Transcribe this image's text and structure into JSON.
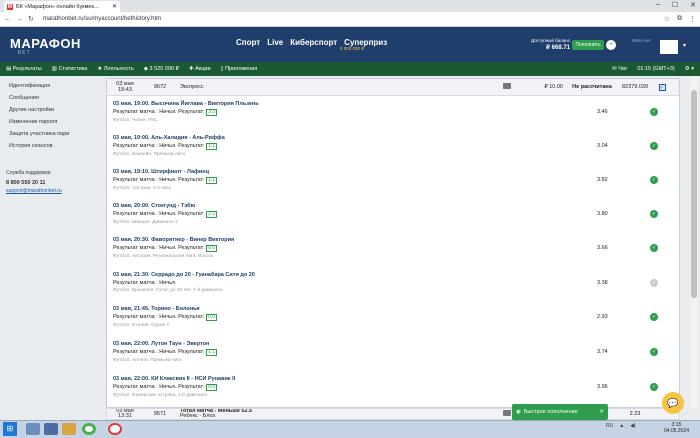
{
  "browser": {
    "tab_title": "БК «Марафон» онлайн букмек...",
    "url": "marathonbet.ru/su/myaccount/bethistory.htm"
  },
  "header": {
    "logo": "МАРАФОН",
    "logo_sub": "БЕТ",
    "nav": [
      "Спорт",
      "Live",
      "Киберспорт",
      "Суперприз"
    ],
    "superprize_amount": "5 000 000 ₽",
    "balance_label": "Доступный баланс",
    "balance_value": "₽ 668.71",
    "deposit_label": "Пополнить",
    "my_account_label": "Мой счет"
  },
  "subnav": {
    "items": [
      "Результаты",
      "Статистика",
      "Лояльность",
      "3 525 000 ₽",
      "Акции",
      "Приложения"
    ],
    "chat": "Чат",
    "time": "01:15 (GMT+3)"
  },
  "sidebar": {
    "items": [
      "Идентификация",
      "Сообщения",
      "Другие настройки",
      "Изменение пароля",
      "Защита участника пари",
      "История сеансов"
    ],
    "support_title": "Служба поддержки",
    "phone": "8 800 550 20 11",
    "email": "support@marathonbet.ru"
  },
  "bet1": {
    "date": "03 мая",
    "time": "18:43",
    "number": "9672",
    "type": "Экспресс",
    "stake": "₽ 10.00",
    "status": "Не рассчитана",
    "code": "82379.039"
  },
  "events": [
    {
      "title": "03 мая, 19:00. Высочина Йиглава - Виктория Пльзень",
      "result": "Результат матча : Ничья. Результат:",
      "score": "3:3",
      "league": "Футбол. Чехия. FNL",
      "odds": "3.46",
      "state": "win"
    },
    {
      "title": "03 мая, 19:00. Аль-Халидия - Аль-Риффа",
      "result": "Результат матча : Ничья. Результат:",
      "score": "1:1",
      "league": "Футбол. Бахрейн. Премьер-лига",
      "odds": "3.04",
      "state": "win"
    },
    {
      "title": "03 мая, 19:10. Штирфингг - Лафинц",
      "result": "Результат матча : Ничья. Результат:",
      "score": "1:1",
      "league": "Футбол. Австрия. 2-я лига",
      "odds": "3.82",
      "state": "win"
    },
    {
      "title": "03 мая, 20:00. Стокгунд - Тэбю",
      "result": "Результат матча : Ничья. Результат:",
      "score": "2:2",
      "league": "Футбол. Швеция. Дивизион 2",
      "odds": "3.80",
      "state": "win"
    },
    {
      "title": "03 мая, 20:30. Фаворитнер - Винер Виктория",
      "result": "Результат матча : Ничья. Результат:",
      "score": "0:0",
      "league": "Футбол. Австрия. Региональная лига. Восток",
      "odds": "3.66",
      "state": "win"
    },
    {
      "title": "03 мая, 21:30. Серрадо до 20 - Гуанабара Сити до 20",
      "result": "Результат матча : Ничья",
      "score": "",
      "league": "Футбол. Бразилия. Голос до 20 лет. 1-й дивизион",
      "odds": "3.38",
      "state": "pending"
    },
    {
      "title": "03 мая, 21:45. Торино - Болонья",
      "result": "Результат матча : Ничья. Результат:",
      "score": "0:0",
      "league": "Футбол. Италия. Серия А",
      "odds": "2.93",
      "state": "win"
    },
    {
      "title": "03 мая, 22:00. Лутон Таун - Эвертон",
      "result": "Результат матча : Ничья. Результат:",
      "score": "1:1",
      "league": "Футбол. Англия. Премьер-лига",
      "odds": "3.74",
      "state": "win"
    },
    {
      "title": "03 мая, 22:00. КИ Клаксвик II - НСИ Рунавик II",
      "result": "Результат матча : Ничья. Результат:",
      "score": "0:0",
      "league": "Футбол. Фарерские острова. 1-й дивизион",
      "odds": "3.96",
      "state": "win"
    }
  ],
  "bet2": {
    "date": "03 мая",
    "time": "13:31",
    "number": "9571",
    "type": "Тотал матча - Меньше 52.5",
    "sub": "Ребекс - Блоз",
    "odds": "2.23"
  },
  "quick_deposit": "Быстрое пополнение",
  "taskbar": {
    "lang": "RU",
    "time": "3:15",
    "date": "04.05.2024"
  }
}
